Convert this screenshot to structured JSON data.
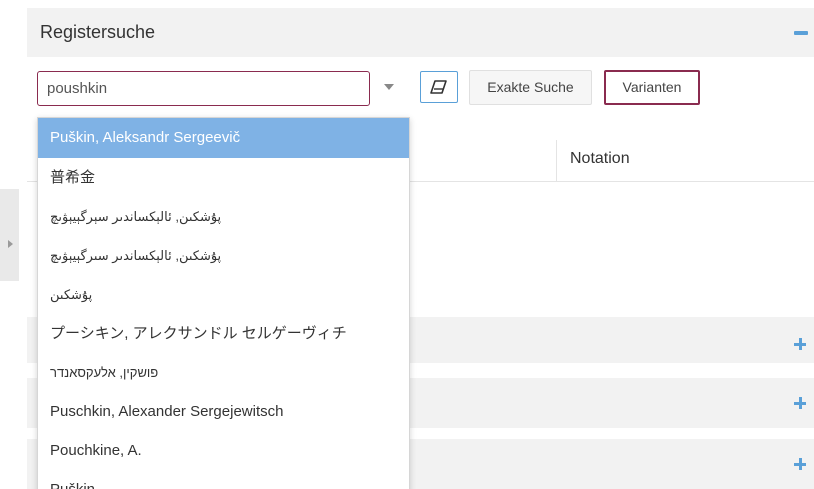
{
  "panel": {
    "title": "Registersuche"
  },
  "search": {
    "value": "poushkin"
  },
  "toolbar": {
    "exakt_label": "Exakte Suche",
    "varianten_label": "Varianten"
  },
  "table": {
    "notation_header": "Notation"
  },
  "suggestions": [
    "Puškin, Aleksandr Sergeevič",
    "普希金",
    "پۇشكىن, ئالېكساندىر سېرگېيېۋىچ",
    "پۇشكىن, ئالېكساندىر سىرگېيېۋىچ",
    "پۇشكىن",
    "プーシキン, アレクサンドル セルゲーヴィチ",
    "פושקין, אלעקסאנדר",
    "Puschkin, Alexander Sergejewitsch",
    "Pouchkine, A.",
    "Puškin"
  ],
  "icons": {
    "collapse": "minus-icon",
    "expand": "plus-icon",
    "dropdown": "chevron-down-icon",
    "eraser": "eraser-icon",
    "sidebar_toggle": "caret-right-icon"
  },
  "colors": {
    "accent_blue": "#5aa0d8",
    "highlight": "#7fb2e5",
    "brand_border": "#8a2b4f",
    "panel_bg": "#f2f2f2"
  }
}
